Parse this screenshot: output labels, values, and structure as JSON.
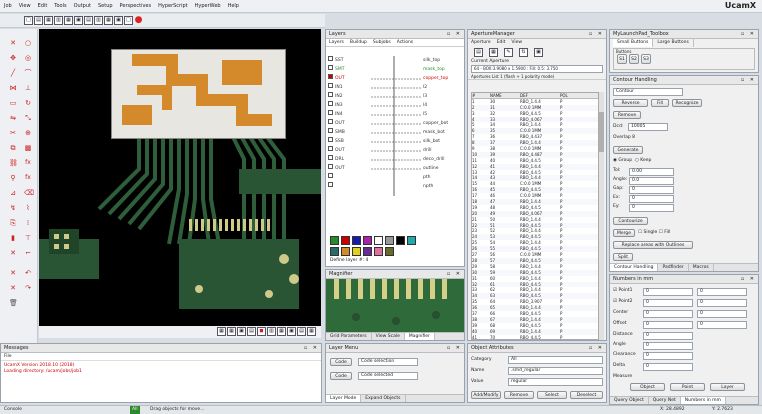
{
  "menu": [
    "Job",
    "View",
    "Edit",
    "Tools",
    "Output",
    "Setup",
    "Perspectives",
    "HyperScript",
    "HyperWeb",
    "Help"
  ],
  "brand": "UcamX",
  "layers": {
    "title": "Layers",
    "tabs": [
      "Layers",
      "Buildup",
      "Subjobs",
      "Actions"
    ],
    "items": [
      {
        "name": "SST",
        "label": "silk_top",
        "color": "#333333"
      },
      {
        "name": "SMT",
        "label": "mask_top",
        "color": "#2a8a2a"
      },
      {
        "name": "OUT",
        "label": "copper_top",
        "color": "#cc0000"
      },
      {
        "name": "IN1",
        "label": "l2",
        "color": "#333333"
      },
      {
        "name": "IN2",
        "label": "l3",
        "color": "#333333"
      },
      {
        "name": "IN3",
        "label": "l4",
        "color": "#333333"
      },
      {
        "name": "IN4",
        "label": "l5",
        "color": "#333333"
      },
      {
        "name": "OUT",
        "label": "copper_bot",
        "color": "#333333"
      },
      {
        "name": "SMB",
        "label": "mask_bot",
        "color": "#333333"
      },
      {
        "name": "SSB",
        "label": "silk_bot",
        "color": "#333333"
      },
      {
        "name": "OUT",
        "label": "drill",
        "color": "#333333"
      },
      {
        "name": "DRL",
        "label": "deco_drill",
        "color": "#333333"
      },
      {
        "name": "OUT",
        "label": "outline",
        "color": "#333333"
      },
      {
        "name": "",
        "label": "pth",
        "color": "#333333"
      },
      {
        "name": "",
        "label": "npth",
        "color": "#333333"
      }
    ],
    "status": "Define layer #: 4"
  },
  "aperture": {
    "title": "ApertureManager",
    "menu": [
      "Aperture",
      "Edit",
      "View"
    ],
    "current_label": "Current Aperture",
    "current": "64 - BOX:3.9080 x 1.5900 : Fill: 0.5: 3.750",
    "header_info": "Apertures List 1 (flash + 1 polarity mode)",
    "columns": [
      "#",
      "NAME",
      "DEF",
      "POL"
    ],
    "rows": [
      [
        "1",
        "30",
        "RBO_1.4.4",
        "P"
      ],
      [
        "2",
        "31",
        "C:0.0 1MM",
        "P"
      ],
      [
        "3",
        "32",
        "RBO_4.4.5",
        "P"
      ],
      [
        "4",
        "33",
        "RBO_4.067",
        "P"
      ],
      [
        "5",
        "34",
        "RBO_1.4.4",
        "P"
      ],
      [
        "6",
        "35",
        "C:0.0 1MM",
        "P"
      ],
      [
        "7",
        "36",
        "RBO_4.437",
        "P"
      ],
      [
        "8",
        "37",
        "RBO_1.4.4",
        "P"
      ],
      [
        "9",
        "38",
        "C:0.0 1MM",
        "P"
      ],
      [
        "10",
        "39",
        "RBO_4.487",
        "P"
      ],
      [
        "11",
        "40",
        "RBO_4.4.5",
        "P"
      ],
      [
        "12",
        "41",
        "RBO_1.4.4",
        "P"
      ],
      [
        "13",
        "42",
        "RBO_4.4.5",
        "P"
      ],
      [
        "14",
        "43",
        "RBO_1.4.4",
        "P"
      ],
      [
        "15",
        "44",
        "C:0.0 1MM",
        "P"
      ],
      [
        "16",
        "45",
        "RBO_4.4.5",
        "P"
      ],
      [
        "17",
        "46",
        "C:0.0 1MM",
        "P"
      ],
      [
        "18",
        "47",
        "RBO_1.4.4",
        "P"
      ],
      [
        "19",
        "48",
        "RBO_4.4.5",
        "P"
      ],
      [
        "20",
        "49",
        "RBO_4.067",
        "P"
      ],
      [
        "21",
        "50",
        "RBO_1.4.4",
        "P"
      ],
      [
        "22",
        "51",
        "RBO_4.4.5",
        "P"
      ],
      [
        "23",
        "52",
        "RBO_1.4.4",
        "P"
      ],
      [
        "24",
        "53",
        "RBO_4.4.5",
        "P"
      ],
      [
        "25",
        "54",
        "RBO_1.4.4",
        "P"
      ],
      [
        "26",
        "55",
        "RBO_4.4.5",
        "P"
      ],
      [
        "27",
        "56",
        "C:0.0 1MM",
        "P"
      ],
      [
        "28",
        "57",
        "RBO_4.4.5",
        "P"
      ],
      [
        "29",
        "58",
        "RBO_1.4.4",
        "P"
      ],
      [
        "30",
        "59",
        "RBO_4.4.5",
        "P"
      ],
      [
        "31",
        "60",
        "RBO_1.4.4",
        "P"
      ],
      [
        "32",
        "61",
        "RBO_4.4.5",
        "P"
      ],
      [
        "33",
        "62",
        "RBO_1.4.4",
        "P"
      ],
      [
        "34",
        "63",
        "RBO_4.4.5",
        "P"
      ],
      [
        "35",
        "64",
        "RBO_3.907",
        "P"
      ],
      [
        "36",
        "65",
        "RBO_1.4.4",
        "P"
      ],
      [
        "37",
        "66",
        "RBO_4.4.5",
        "P"
      ],
      [
        "38",
        "67",
        "RBO_1.4.4",
        "P"
      ],
      [
        "39",
        "68",
        "RBO_4.4.5",
        "P"
      ],
      [
        "40",
        "69",
        "RBO_1.4.4",
        "P"
      ],
      [
        "41",
        "70",
        "RBO_4.4.5",
        "P"
      ],
      [
        "42",
        "71",
        "RBO_1.4.4",
        "P"
      ],
      [
        "43",
        "72",
        "RBO_4.4.5",
        "P"
      ],
      [
        "44",
        "73",
        "RBO_1.4.4",
        "P"
      ],
      [
        "45",
        "74",
        "RBO_4.4.5",
        "P"
      ],
      [
        "46",
        "75",
        "RBO_1.4.4",
        "P"
      ],
      [
        "47",
        "76",
        "RBO_4.4.5",
        "P"
      ],
      [
        "48",
        "77",
        "RBO_1.4.4",
        "P"
      ]
    ]
  },
  "launchpad": {
    "title": "MyLaunchPad_Toolbox",
    "tabs": [
      "Small Buttons",
      "Large Buttons"
    ],
    "group": "Buttons",
    "buttons": [
      "S1",
      "S2",
      "S3"
    ]
  },
  "contour": {
    "title": "Contour Handling",
    "field1": "Contour",
    "btn_reverse": "Reverse",
    "btn_fill": "Fill",
    "btn_recognize": "Recognize",
    "btn_remove": "Remove",
    "dcode_label": "Dcd:",
    "dcode_value": "10005",
    "overlap_label": "Overlap 8",
    "btn_generate": "Generate",
    "opt1": "Group",
    "opt2": "Keep",
    "params": [
      {
        "label": "Tol:",
        "value": "0.00"
      },
      {
        "label": "Angle:",
        "value": "0.0"
      },
      {
        "label": "Gap:",
        "value": "0"
      },
      {
        "label": "Ex:",
        "value": "0"
      },
      {
        "label": "Ey:",
        "value": "0"
      }
    ],
    "btn_contour": "Contourize",
    "btn_merge": "Merge",
    "opt_single": "Single",
    "opt_fill": "Fill",
    "btn_replace": "Replace areas with Outlines",
    "btn_split": "Split",
    "tabs": [
      "Contour Handling",
      "Padfinder",
      "Macros"
    ]
  },
  "numbers": {
    "title": "Numbers in mm",
    "point1_label": "Point1",
    "point1": [
      "0",
      "0"
    ],
    "point2_label": "Point2",
    "point2": [
      "0",
      "0"
    ],
    "center_label": "Center",
    "center": [
      "0",
      "0"
    ],
    "offset_label": "Offset",
    "offset": [
      "0",
      "0"
    ],
    "distance_label": "Distance",
    "distance": "0",
    "angle_label": "Angle",
    "angle": "0",
    "clearance_label": "Clearance",
    "clearance": "0",
    "delta_label": "Delta",
    "delta": "0",
    "measure": "Measure",
    "btn_object": "Object",
    "btn_point": "Point",
    "btn_layer": "Layer",
    "tabs": [
      "Query Object",
      "Query Net",
      "Numbers in mm"
    ]
  },
  "magnifier": {
    "title": "Magnifier",
    "tabs": [
      "Grid Parameters",
      "View Scale",
      "Magnifier"
    ]
  },
  "messages": {
    "title": "Messages",
    "filter": "File",
    "lines": [
      {
        "text": "UcamX Version 2018.10 (2018)",
        "color": "#cc0000"
      },
      {
        "text": "Loading directory: /ucam/jobs/job1",
        "color": "#cc0000"
      }
    ]
  },
  "layer_menu": {
    "title": "Layer Menu",
    "btn1": "Code",
    "field1": "Code selection",
    "btn2": "Code",
    "field2": "Code selected",
    "tabs": [
      "Layer Mode",
      "Expand Objects"
    ]
  },
  "object_attr": {
    "title": "Object Attributes",
    "category_label": "Category",
    "category": "All",
    "name_label": "Name",
    "name": ".smd_regular",
    "value_label": "Value",
    "value": "regular",
    "btn_add": "Add/Modify",
    "btn_remove": "Remove",
    "btn_select": "Select",
    "btn_deselect": "Deselect"
  },
  "status": {
    "left": "Console",
    "mode": "All",
    "hint": "Drag objects for move...",
    "coord_x": "X: 28.4892",
    "coord_y": "Y: 2.7623"
  },
  "colors": {
    "board_bg": "#000000",
    "copper": "#2f5f3a",
    "pad": "#cfc98a",
    "accent": "#3b6fb5"
  }
}
